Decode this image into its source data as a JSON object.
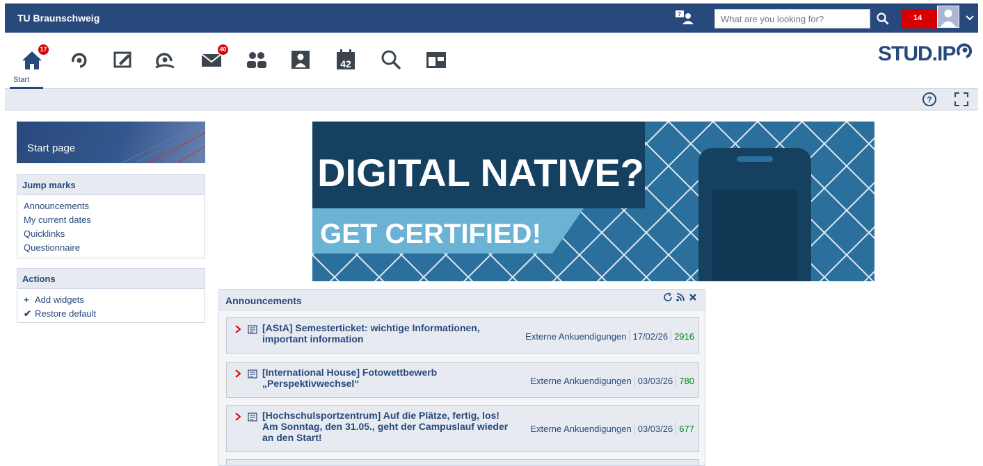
{
  "topbar": {
    "brand": "TU Braunschweig",
    "search_placeholder": "What are you looking for?",
    "notification_count": "14"
  },
  "nav": {
    "start_label": "Start",
    "start_badge": "17",
    "messages_badge": "40",
    "calendar_day": "42",
    "logo_text": "STUD.IP"
  },
  "sidebar": {
    "title": "Start page",
    "jump_marks": {
      "title": "Jump marks",
      "links": [
        "Announcements",
        "My current dates",
        "Quicklinks",
        "Questionnaire"
      ]
    },
    "actions": {
      "title": "Actions",
      "items": [
        "Add widgets",
        "Restore default"
      ]
    }
  },
  "banner": {
    "headline": "DIGITAL NATIVE?",
    "subline": "GET CERTIFIED!"
  },
  "announcements": {
    "title": "Announcements",
    "items": [
      {
        "title": "[AStA] Semesterticket: wichtige Informationen, important information",
        "category": "Externe Ankuendigungen",
        "date": "17/02/26",
        "views": "2916"
      },
      {
        "title": "[International House] Fotowettbewerb „Perspektivwechsel“",
        "category": "Externe Ankuendigungen",
        "date": "03/03/26",
        "views": "780"
      },
      {
        "title": "[Hochschulsportzentrum] Auf die Plätze, fertig, los! Am Sonntag, den 31.05., geht der Campuslauf wieder an den Start!",
        "category": "Externe Ankuendigungen",
        "date": "03/03/26",
        "views": "677"
      }
    ]
  },
  "colors": {
    "brand_blue": "#28497c",
    "badge_red": "#d60000",
    "views_green": "#008512"
  }
}
